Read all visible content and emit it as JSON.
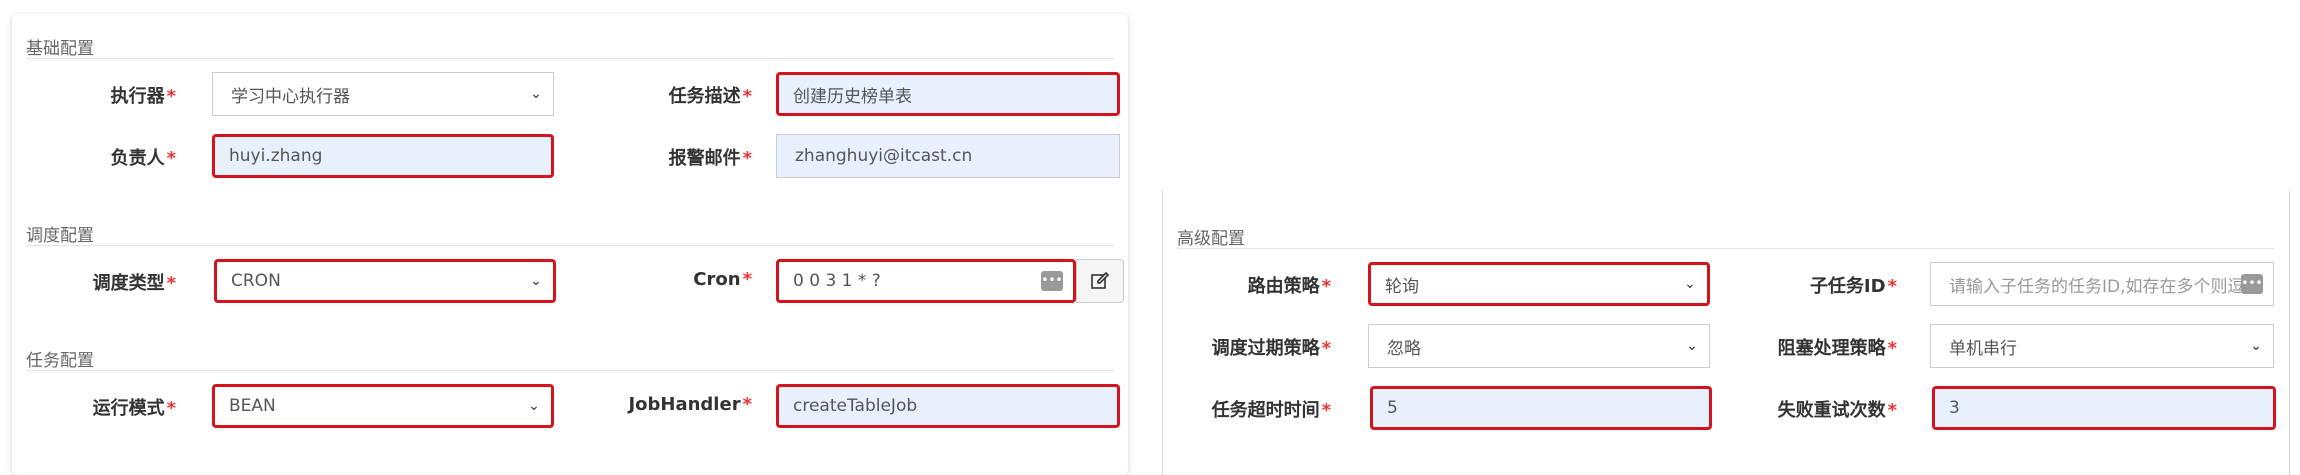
{
  "left": {
    "sections": {
      "basic": "基础配置",
      "schedule": "调度配置",
      "task": "任务配置"
    },
    "executor": {
      "label": "执行器",
      "value": "学习中心执行器"
    },
    "task_desc": {
      "label": "任务描述",
      "value": "创建历史榜单表"
    },
    "owner": {
      "label": "负责人",
      "value": "huyi.zhang"
    },
    "alarm_email": {
      "label": "报警邮件",
      "value": "zhanghuyi@itcast.cn"
    },
    "schedule_type": {
      "label": "调度类型",
      "value": "CRON"
    },
    "cron": {
      "label": "Cron",
      "value": "0 0 3 1 * ?"
    },
    "run_mode": {
      "label": "运行模式",
      "value": "BEAN"
    },
    "job_handler": {
      "label": "JobHandler",
      "value": "createTableJob"
    }
  },
  "right": {
    "section": "高级配置",
    "route_strategy": {
      "label": "路由策略",
      "value": "轮询"
    },
    "child_task": {
      "label": "子任务ID",
      "placeholder": "请输入子任务的任务ID,如存在多个则逗"
    },
    "misfire_strategy": {
      "label": "调度过期策略",
      "value": "忽略"
    },
    "block_strategy": {
      "label": "阻塞处理策略",
      "value": "单机串行"
    },
    "timeout": {
      "label": "任务超时时间",
      "value": "5"
    },
    "retry": {
      "label": "失败重试次数",
      "value": "3"
    }
  },
  "required_mark": "*",
  "colors": {
    "highlight": "#d4141c",
    "filled_bg": "#e8f0fe",
    "required": "#e33"
  }
}
